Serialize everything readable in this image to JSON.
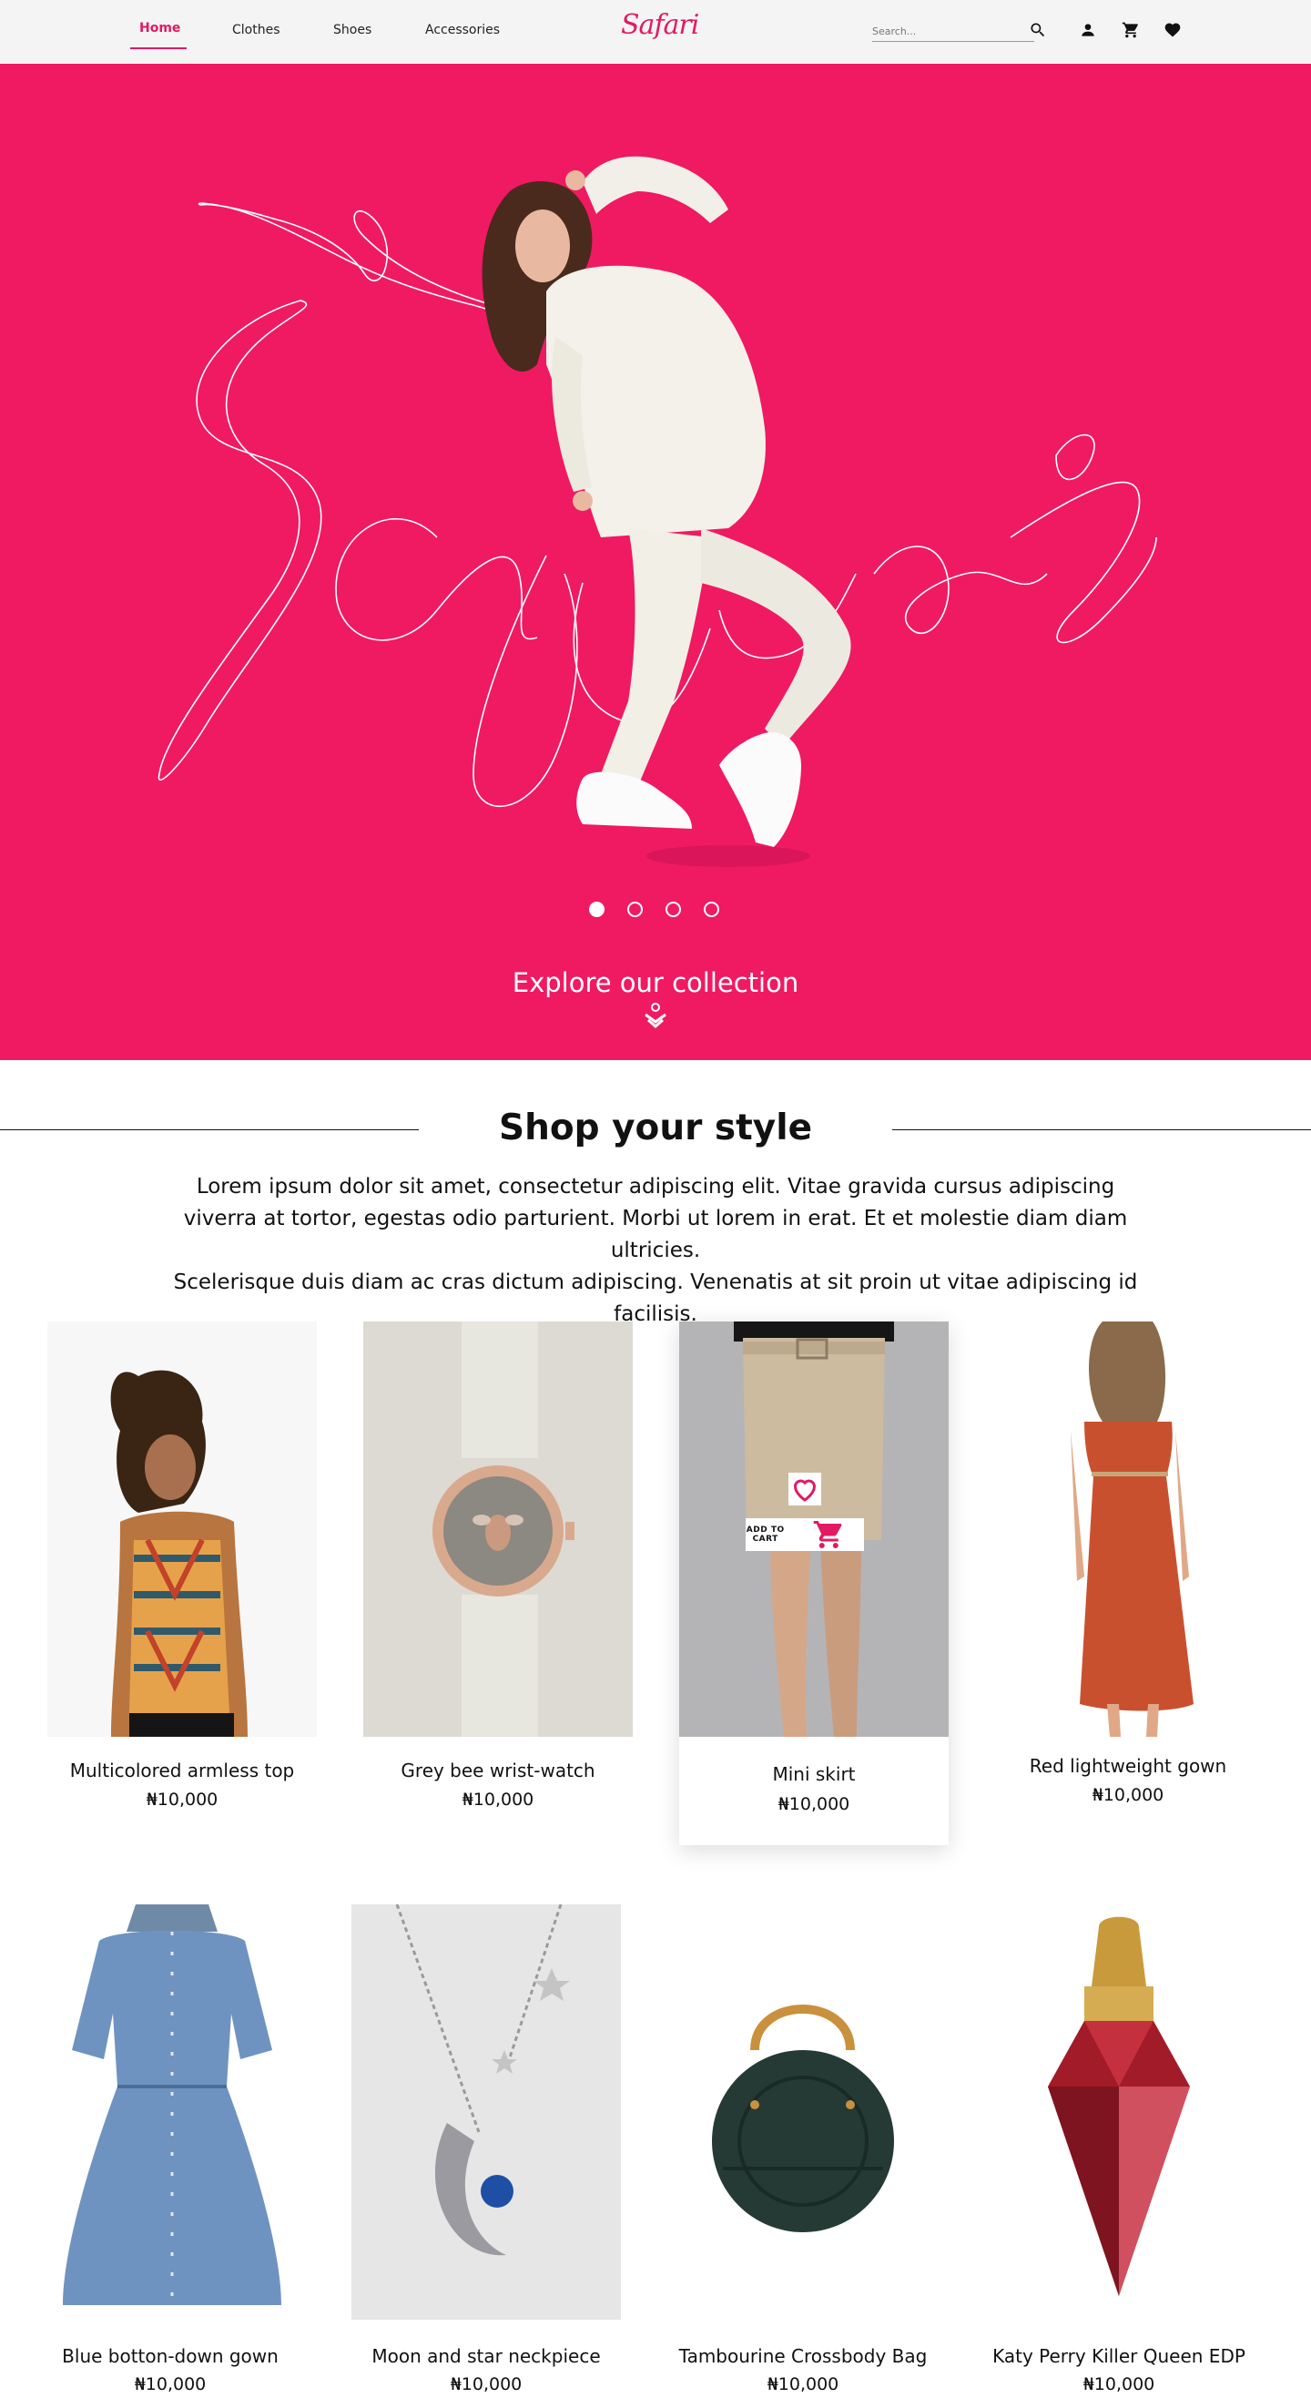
{
  "nav": {
    "items": [
      "Home",
      "Clothes",
      "Shoes",
      "Accessories"
    ],
    "logo": "Safari",
    "search_placeholder": "Search..."
  },
  "hero": {
    "slide_count": 4,
    "active_slide": 1,
    "cta": "Explore our collection"
  },
  "section": {
    "title": "Shop your style",
    "lede_lines": [
      "Lorem ipsum dolor sit amet, consectetur adipiscing elit. Vitae gravida cursus adipiscing",
      "viverra at tortor, egestas odio parturient. Morbi ut lorem in erat. Et et molestie diam diam ultricies.",
      "Scelerisque duis diam ac cras dictum adipiscing. Venenatis at sit proin ut vitae adipiscing id facilisis."
    ]
  },
  "products": [
    {
      "name": "Multicolored armless top",
      "price": "₦10,000"
    },
    {
      "name": "Grey bee wrist-watch",
      "price": "₦10,000"
    },
    {
      "name": "Mini skirt",
      "price": "₦10,000"
    },
    {
      "name": "Red lightweight gown",
      "price": "₦10,000"
    },
    {
      "name": "Blue botton-down gown",
      "price": "₦10,000"
    },
    {
      "name": "Moon and star neckpiece",
      "price": "₦10,000"
    },
    {
      "name": "Tambourine Crossbody Bag",
      "price": "₦10,000"
    },
    {
      "name": "Katy Perry Killer Queen EDP",
      "price": "₦10,000"
    }
  ],
  "hover_card": {
    "add_to_cart_label": "ADD TO CART"
  },
  "colors": {
    "accent": "#e21963",
    "hero_bg": "#ef1a62",
    "nav_bg": "#f4f4f4"
  }
}
